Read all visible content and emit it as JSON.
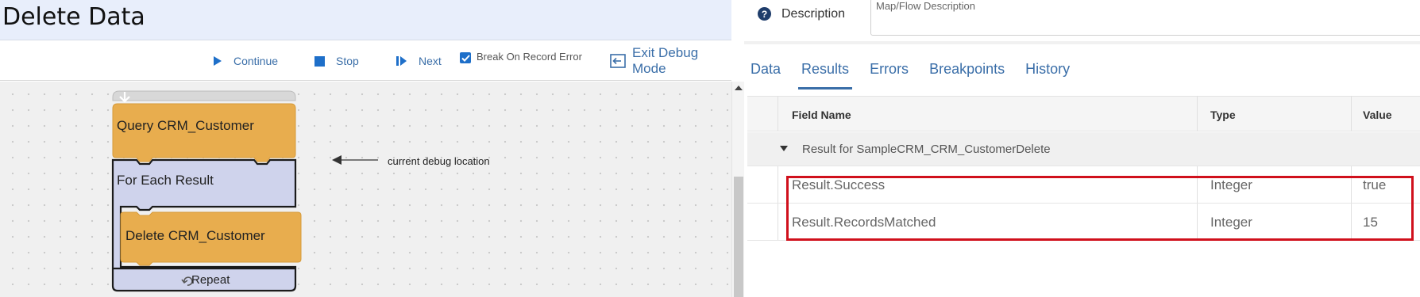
{
  "page": {
    "title": "Delete Data"
  },
  "toolbar": {
    "continue_label": "Continue",
    "stop_label": "Stop",
    "next_label": "Next",
    "break_on_error_label": "Break On Record Error",
    "break_on_error_checked": true,
    "exit_label": "Exit Debug Mode"
  },
  "canvas": {
    "blocks": {
      "query_label": "Query CRM_Customer",
      "foreach_label": "For Each Result",
      "delete_label": "Delete CRM_Customer",
      "repeat_label": "Repeat"
    },
    "annotation": "current debug location"
  },
  "description": {
    "label": "Description",
    "placeholder": "Map/Flow Description"
  },
  "results": {
    "tabs": [
      {
        "label": "Data"
      },
      {
        "label": "Results",
        "active": true
      },
      {
        "label": "Errors"
      },
      {
        "label": "Breakpoints"
      },
      {
        "label": "History"
      }
    ],
    "columns": {
      "field": "Field Name",
      "type": "Type",
      "value": "Value"
    },
    "group_label": "Result for SampleCRM_CRM_CustomerDelete",
    "rows": [
      {
        "field": "Result.Success",
        "type": "Integer",
        "value": "true"
      },
      {
        "field": "Result.RecordsMatched",
        "type": "Integer",
        "value": "15"
      }
    ]
  },
  "colors": {
    "accent": "#3a6ea8",
    "block_orange": "#e8ad4e",
    "block_lavender": "#cfd3ec",
    "highlight": "#d0101c"
  }
}
